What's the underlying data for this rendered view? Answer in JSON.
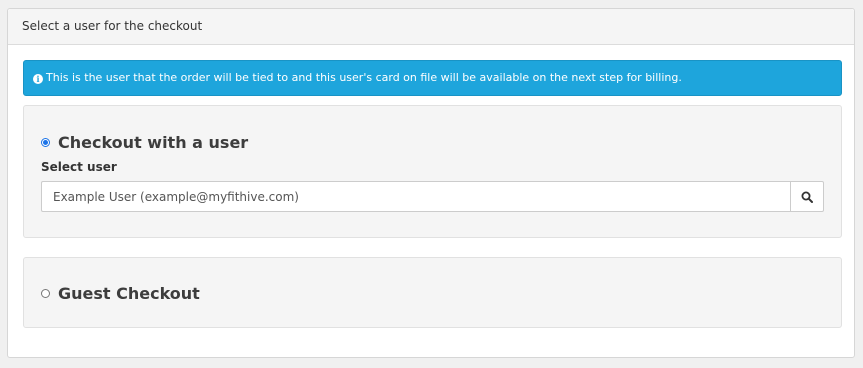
{
  "panel": {
    "heading": "Select a user for the checkout"
  },
  "alert": {
    "icon": "info-circle-icon",
    "text": "This is the user that the order will be tied to and this user's card on file will be available on the next step for billing.",
    "background_color": "#1ea5dc"
  },
  "checkout_user": {
    "label": "Checkout with a user",
    "selected": true,
    "field_label": "Select user",
    "input_value": "Example User (example@myfithive.com)",
    "search_icon": "search-icon"
  },
  "guest": {
    "label": "Guest Checkout",
    "selected": false
  },
  "colors": {
    "radio_accent": "#1a73e8"
  }
}
